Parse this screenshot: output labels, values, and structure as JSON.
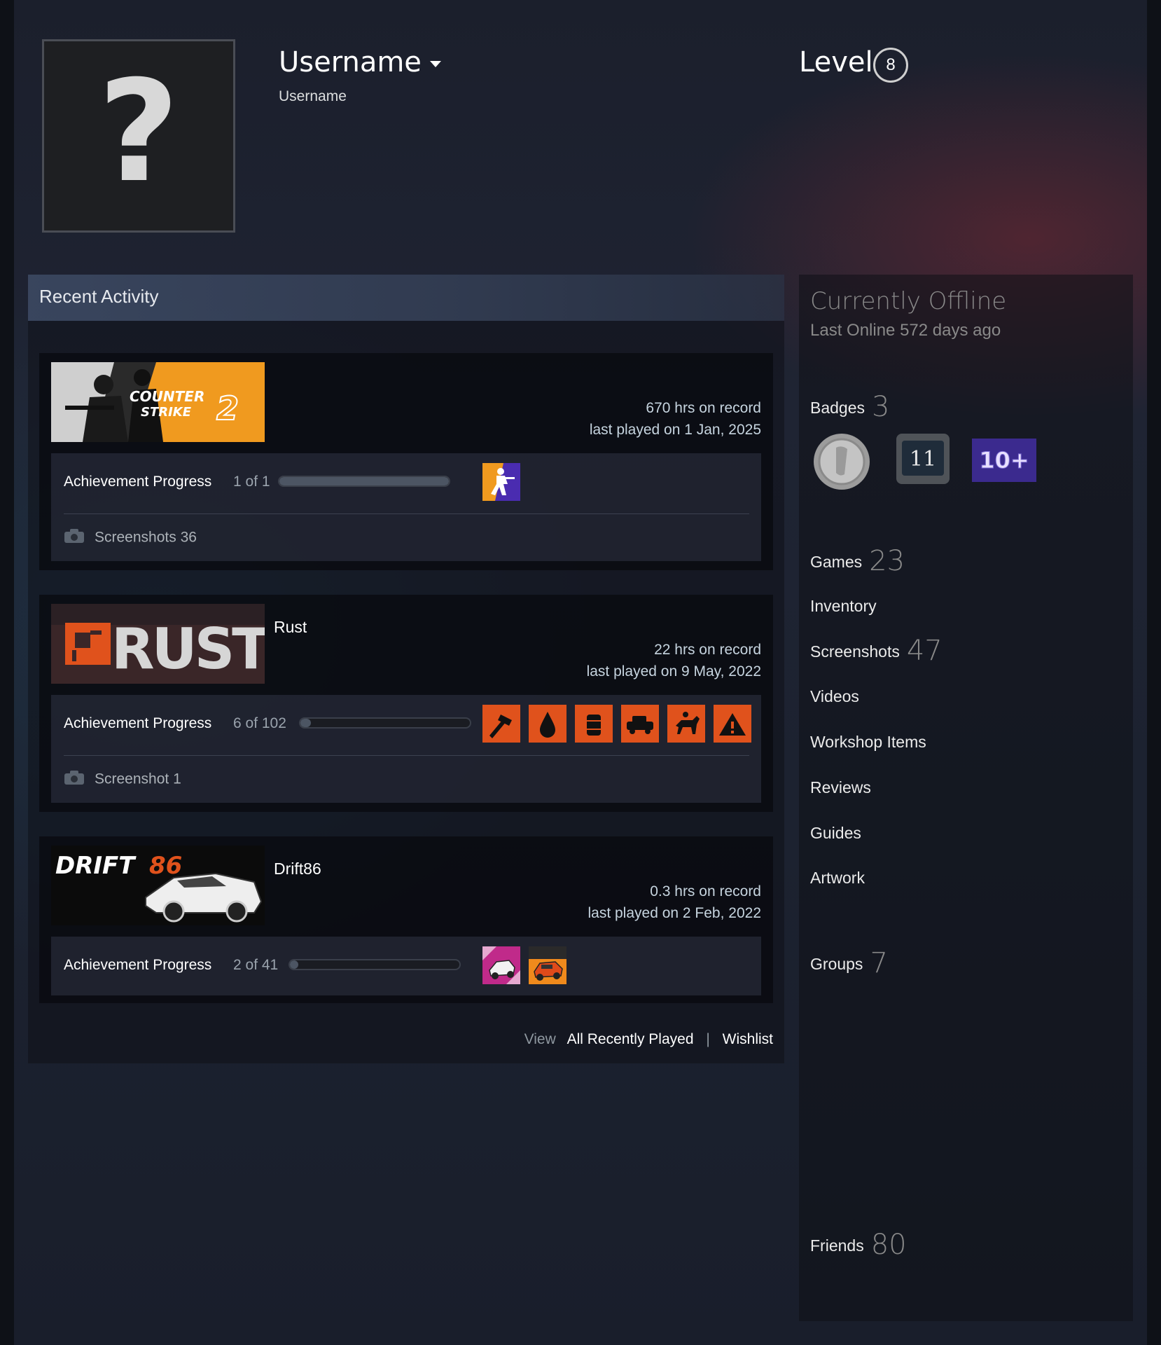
{
  "profile": {
    "avatar_symbol": "?",
    "persona_name": "Username",
    "sub_name": "Username",
    "level_label": "Level",
    "level_value": "8"
  },
  "recent_activity": {
    "title": "Recent Activity",
    "games": [
      {
        "name": "",
        "capsule_text_line1": "COUNTER",
        "capsule_text_line2": "STRIKE",
        "capsule_number": "2",
        "hours": "670 hrs on record",
        "last_played": "last played on 1 Jan, 2025",
        "achievement_label": "Achievement Progress",
        "achievement_count": "1 of 1",
        "achievement_fraction": 1.0,
        "screenshots": "Screenshots 36"
      },
      {
        "name": "Rust",
        "capsule_text": "RUST",
        "hours": "22 hrs on record",
        "last_played": "last played on 9 May, 2022",
        "achievement_label": "Achievement Progress",
        "achievement_count": "6 of 102",
        "achievement_fraction": 0.06,
        "screenshots": "Screenshot 1"
      },
      {
        "name": "Drift86",
        "capsule_text_a": "DRIFT",
        "capsule_text_b": "86",
        "hours": "0.3 hrs on record",
        "last_played": "last played on 2 Feb, 2022",
        "achievement_label": "Achievement Progress",
        "achievement_count": "2 of 41",
        "achievement_fraction": 0.05
      }
    ],
    "footer": {
      "view": "View",
      "all_recently_played": "All Recently Played",
      "separator": "|",
      "wishlist": "Wishlist"
    }
  },
  "sidebar": {
    "status": "Currently Offline",
    "last_online": "Last Online 572 days ago",
    "badges_label": "Badges",
    "badges_count": "3",
    "badge_2_text": "11",
    "badge_3_text": "10+",
    "games_label": "Games",
    "games_count": "23",
    "inventory": "Inventory",
    "screenshots_label": "Screenshots",
    "screenshots_count": "47",
    "videos": "Videos",
    "workshop": "Workshop Items",
    "reviews": "Reviews",
    "guides": "Guides",
    "artwork": "Artwork",
    "groups_label": "Groups",
    "groups_count": "7",
    "friends_label": "Friends",
    "friends_count": "80"
  },
  "colors": {
    "accent_orange": "#e0521c",
    "cs_orange": "#f09a1f",
    "text_muted": "#898989"
  }
}
